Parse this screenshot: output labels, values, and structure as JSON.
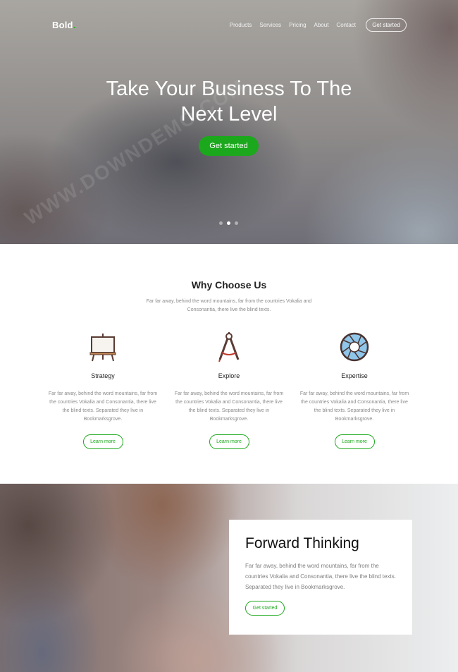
{
  "header": {
    "logo_text": "Bold",
    "logo_dot": ".",
    "nav": [
      "Products",
      "Services",
      "Pricing",
      "About",
      "Contact"
    ],
    "cta_label": "Get started"
  },
  "hero": {
    "title_line1": "Take Your Business To The",
    "title_line2": "Next Level",
    "button_label": "Get started",
    "slides_total": 3,
    "active_slide": 2
  },
  "why": {
    "title": "Why Choose Us",
    "intro": "Far far away, behind the word mountains, far from the countries Vokalia and Consonantia, there live the blind texts.",
    "features": [
      {
        "icon": "easel-icon",
        "title": "Strategy",
        "text": "Far far away, behind the word mountains, far from the countries Vokalia and Consonantia, there live the blind texts. Separated they live in Bookmarksgrove.",
        "button": "Learn more"
      },
      {
        "icon": "compass-icon",
        "title": "Explore",
        "text": "Far far away, behind the word mountains, far from the countries Vokalia and Consonantia, there live the blind texts. Separated they live in Bookmarksgrove.",
        "button": "Learn more"
      },
      {
        "icon": "aperture-icon",
        "title": "Expertise",
        "text": "Far far away, behind the word mountains, far from the countries Vokalia and Consonantia, there live the blind texts. Separated they live in Bookmarksgrove.",
        "button": "Learn more"
      }
    ]
  },
  "forward": {
    "title": "Forward Thinking",
    "text": "Far far away, behind the word mountains, far from the countries Vokalia and Consonantia, there live the blind texts. Separated they live in Bookmarksgrove.",
    "button": "Get started"
  },
  "watermark": "WWW.DOWNDEMO.COM",
  "colors": {
    "accent": "#1ca81c",
    "text_dark": "#222222",
    "text_muted": "#8a8a8a"
  }
}
